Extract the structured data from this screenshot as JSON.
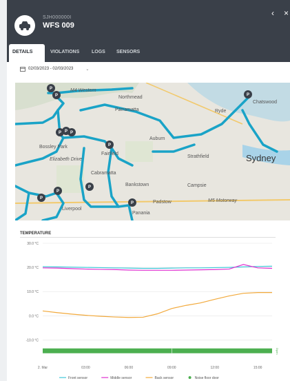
{
  "vehicle": {
    "id": "SJH000000I",
    "name": "WFS 009"
  },
  "tabs": [
    {
      "label": "DETAILS"
    },
    {
      "label": "VIOLATIONS"
    },
    {
      "label": "LOGS"
    },
    {
      "label": "SENSORS"
    }
  ],
  "date_range": "02/03/2023 - 02/03/2023",
  "map": {
    "labels": [
      "Northmead",
      "Parramatta",
      "Auburn",
      "Strathfield",
      "Sydney",
      "Bankstown",
      "Campsie",
      "Bossley Park",
      "Fairfield",
      "Cabramatta",
      "Chatswood",
      "Ryde",
      "Padstow",
      "Panania",
      "Liverpool"
    ],
    "road_labels": [
      "M4 Western",
      "M5 Motorway",
      "Elizabeth Drive"
    ],
    "colors": {
      "route": "#1aa3c7",
      "water": "#a9d3e8",
      "land": "#e8e6df"
    }
  },
  "chart_title": "TEMPERATURE",
  "chart_data": {
    "type": "line",
    "title": "TEMPERATURE",
    "yticks": [
      "30.0 °C",
      "20.0 °C",
      "10.0 °C",
      "0.0 °C",
      "-10.0 °C"
    ],
    "xticks": [
      "2. Mar",
      "03:00",
      "06:00",
      "09:00",
      "12:00",
      "15:00"
    ],
    "ylim": [
      -17,
      30
    ],
    "x_hours": [
      0,
      1,
      2,
      3,
      4,
      5,
      6,
      7,
      8,
      9,
      10,
      11,
      12,
      13,
      14,
      15,
      16
    ],
    "series": [
      {
        "name": "Front sensor",
        "color": "#3fc8d8",
        "values": [
          20.3,
          20.2,
          20.1,
          20.0,
          19.9,
          19.8,
          19.7,
          19.6,
          19.6,
          19.7,
          19.8,
          19.8,
          19.9,
          20.0,
          20.2,
          20.4,
          20.5
        ]
      },
      {
        "name": "Middle sensor",
        "color": "#e02fd0",
        "values": [
          19.8,
          19.7,
          19.5,
          19.3,
          19.2,
          19.1,
          18.9,
          18.8,
          18.8,
          18.8,
          18.9,
          19.0,
          19.1,
          19.3,
          21.2,
          19.8,
          19.6
        ]
      },
      {
        "name": "Back sensor",
        "color": "#f2a93b",
        "values": [
          2.0,
          1.3,
          0.7,
          0.2,
          -0.2,
          -0.5,
          -0.7,
          -0.6,
          0.8,
          3.0,
          4.3,
          5.3,
          6.8,
          8.2,
          9.3,
          9.6,
          9.6
        ]
      },
      {
        "name": "Noise floor door",
        "color": "#4caf50",
        "type": "band",
        "label": "Open"
      }
    ],
    "legend": "bottom"
  }
}
